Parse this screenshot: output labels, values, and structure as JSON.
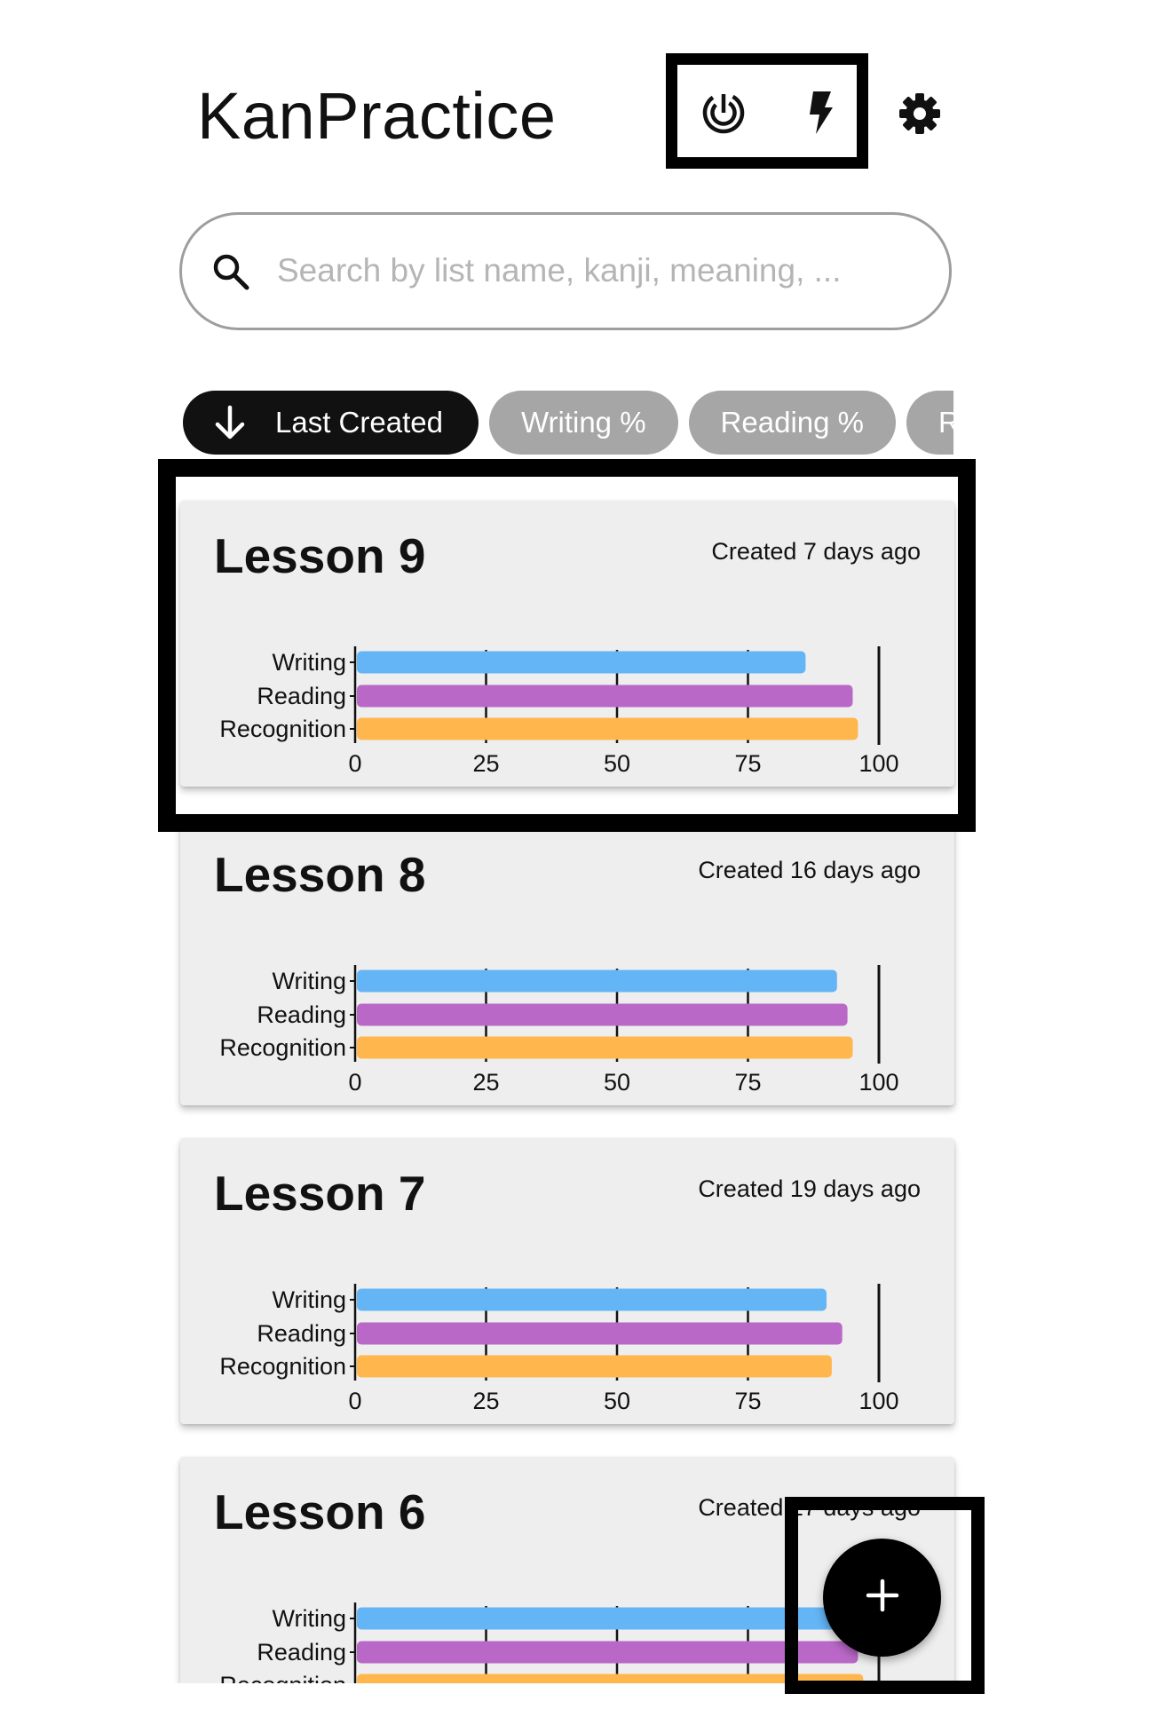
{
  "header": {
    "title": "KanPractice",
    "icons": [
      "stats-icon",
      "bolt-icon",
      "settings-icon"
    ]
  },
  "search": {
    "placeholder": "Search by list name, kanji, meaning, ...",
    "value": ""
  },
  "filters": [
    {
      "label": "Last Created",
      "active": true,
      "icon": "arrow-down-icon"
    },
    {
      "label": "Writing %",
      "active": false
    },
    {
      "label": "Reading %",
      "active": false
    },
    {
      "label": "Recognition %",
      "active": false
    }
  ],
  "lists": [
    {
      "title": "Lesson 9",
      "created": "Created 7 days ago",
      "chart_data": {
        "type": "bar",
        "orientation": "horizontal",
        "categories": [
          "Writing",
          "Reading",
          "Recognition"
        ],
        "values": [
          86,
          95,
          96
        ],
        "xlim": [
          0,
          100
        ],
        "xticks": [
          "0",
          "25",
          "50",
          "75",
          "100"
        ],
        "colors": [
          "#64b5f6",
          "#ba68c8",
          "#ffb74d"
        ]
      }
    },
    {
      "title": "Lesson 8",
      "created": "Created 16 days ago",
      "chart_data": {
        "type": "bar",
        "orientation": "horizontal",
        "categories": [
          "Writing",
          "Reading",
          "Recognition"
        ],
        "values": [
          92,
          94,
          95
        ],
        "xlim": [
          0,
          100
        ],
        "xticks": [
          "0",
          "25",
          "50",
          "75",
          "100"
        ],
        "colors": [
          "#64b5f6",
          "#ba68c8",
          "#ffb74d"
        ]
      }
    },
    {
      "title": "Lesson 7",
      "created": "Created 19 days ago",
      "chart_data": {
        "type": "bar",
        "orientation": "horizontal",
        "categories": [
          "Writing",
          "Reading",
          "Recognition"
        ],
        "values": [
          90,
          93,
          91
        ],
        "xlim": [
          0,
          100
        ],
        "xticks": [
          "0",
          "25",
          "50",
          "75",
          "100"
        ],
        "colors": [
          "#64b5f6",
          "#ba68c8",
          "#ffb74d"
        ]
      }
    },
    {
      "title": "Lesson 6",
      "created": "Created 27 days ago",
      "chart_data": {
        "type": "bar",
        "orientation": "horizontal",
        "categories": [
          "Writing",
          "Reading",
          "Recognition"
        ],
        "values": [
          92,
          96,
          97
        ],
        "xlim": [
          0,
          100
        ],
        "xticks": [
          "0",
          "25",
          "50",
          "75",
          "100"
        ],
        "colors": [
          "#64b5f6",
          "#ba68c8",
          "#ffb74d"
        ]
      }
    }
  ],
  "fab": {
    "label": "+",
    "icon": "plus-icon"
  }
}
